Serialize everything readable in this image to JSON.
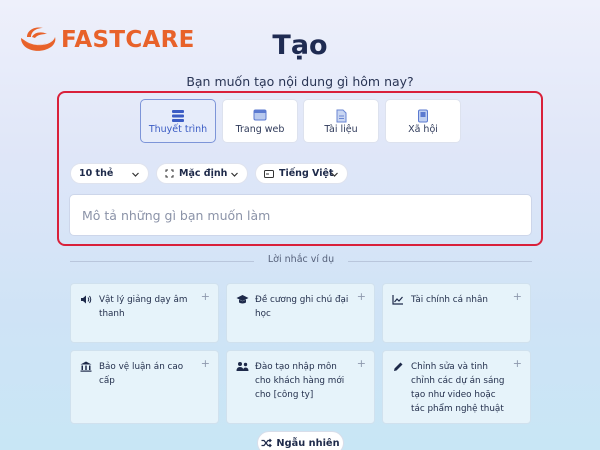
{
  "brand": {
    "name": "FASTCARE",
    "color": "#e8622a"
  },
  "page": {
    "title": "Tạo",
    "subtitle": "Bạn muốn tạo nội dung gì hôm nay?"
  },
  "content_types": [
    {
      "label": "Thuyết trình",
      "icon": "presentation-icon",
      "selected": true
    },
    {
      "label": "Trang web",
      "icon": "webpage-icon",
      "selected": false
    },
    {
      "label": "Tài liệu",
      "icon": "document-icon",
      "selected": false
    },
    {
      "label": "Xã hội",
      "icon": "social-icon",
      "selected": false
    }
  ],
  "options": {
    "cards_count": "10 thẻ",
    "layout": "Mặc định",
    "language": "Tiếng Việt"
  },
  "prompt": {
    "placeholder": "Mô tả những gì bạn muốn làm",
    "value": ""
  },
  "suggestions": {
    "heading": "Lời nhắc ví dụ",
    "items": [
      {
        "text": "Vật lý giảng dạy âm thanh",
        "icon": "speaker-icon"
      },
      {
        "text": "Đề cương ghi chú đại học",
        "icon": "graduation-cap-icon"
      },
      {
        "text": "Tài chính cá nhân",
        "icon": "chart-line-icon"
      },
      {
        "text": "Bảo vệ luận án cao cấp",
        "icon": "institution-icon"
      },
      {
        "text": "Đào tạo nhập môn cho khách hàng mới cho [công ty]",
        "icon": "people-icon"
      },
      {
        "text": "Chỉnh sửa và tinh chỉnh các dự án sáng tạo như video hoặc tác phẩm nghệ thuật",
        "icon": "pen-icon"
      }
    ]
  },
  "random_button": {
    "label": "Ngẫu nhiên"
  },
  "colors": {
    "accent": "#3b5cc4",
    "highlight_border": "#d9203a"
  }
}
